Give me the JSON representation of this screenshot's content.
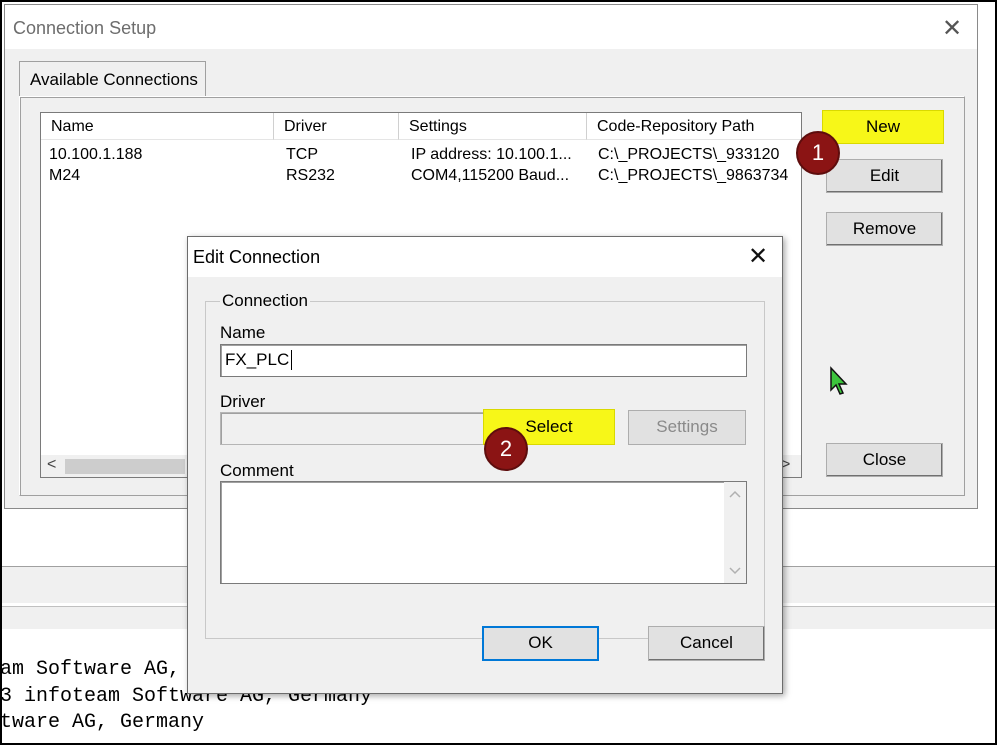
{
  "console": {
    "lines": [
      "am Software AG,",
      "3 infoteam Software AG, Germany",
      "tware AG, Germany"
    ]
  },
  "setup": {
    "title": "Connection Setup",
    "tab": "Available Connections",
    "columns": [
      "Name",
      "Driver",
      "Settings",
      "Code-Repository Path"
    ],
    "rows": [
      {
        "name": "10.100.1.188",
        "driver": "TCP",
        "settings": "IP address: 10.100.1...",
        "path": "C:\\_PROJECTS\\_933120"
      },
      {
        "name": "M24",
        "driver": "RS232",
        "settings": "COM4,115200 Baud...",
        "path": "C:\\_PROJECTS\\_9863734"
      }
    ],
    "buttons": {
      "new": "New",
      "edit": "Edit",
      "remove": "Remove",
      "close": "Close"
    },
    "badge1": "1"
  },
  "edit": {
    "title": "Edit Connection",
    "group": "Connection",
    "name_label": "Name",
    "name_value": "FX_PLC",
    "driver_label": "Driver",
    "driver_value": "",
    "select": "Select",
    "settings": "Settings",
    "comment_label": "Comment",
    "ok": "OK",
    "cancel": "Cancel",
    "badge2": "2"
  },
  "colors": {
    "highlight": "#f7f718",
    "badge": "#8b1414"
  }
}
